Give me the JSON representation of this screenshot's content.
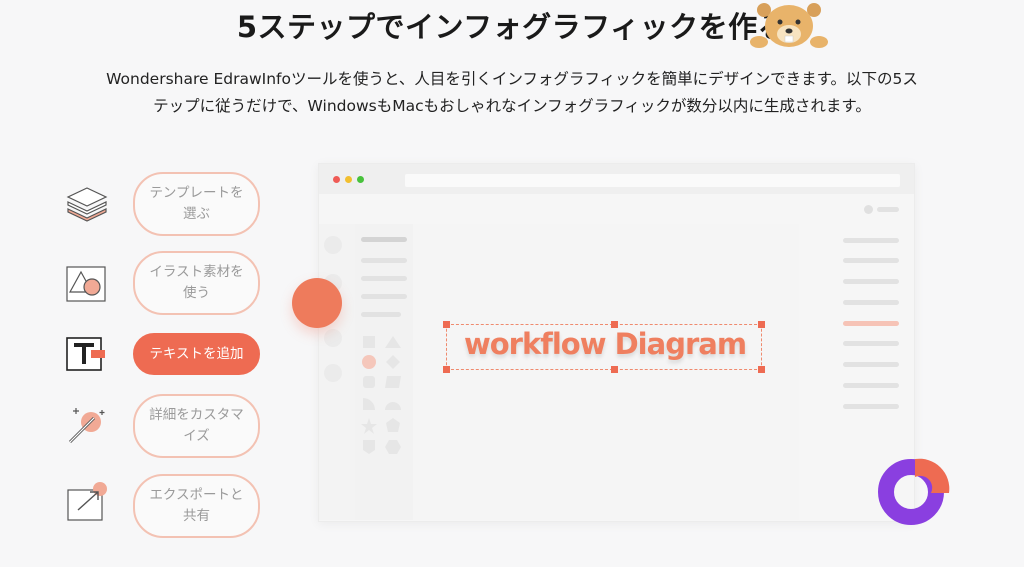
{
  "header": {
    "title": "5ステップでインフォグラフィックを作る",
    "description_line1": "Wondershare EdrawInfoツールを使うと、人目を引くインフォグラフィックを簡単にデザインできます。以下の5ス",
    "description_line2": "テップに従うだけで、WindowsもMacもおしゃれなインフォグラフィックが数分以内に生成されます。"
  },
  "steps": [
    {
      "label": "テンプレートを選ぶ",
      "icon": "layers-icon",
      "active": false
    },
    {
      "label": "イラスト素材を使う",
      "icon": "shapes-icon",
      "active": false
    },
    {
      "label": "テキストを追加",
      "icon": "text-icon",
      "active": true
    },
    {
      "label": "詳細をカスタマイズ",
      "icon": "magic-wand-icon",
      "active": false
    },
    {
      "label": "エクスポートと共有",
      "icon": "export-icon",
      "active": false
    }
  ],
  "canvas": {
    "text": "workflow Diagram"
  },
  "colors": {
    "accent": "#ee6b52",
    "accent_light": "#f3c2b3",
    "purple": "#8a3fe0"
  }
}
